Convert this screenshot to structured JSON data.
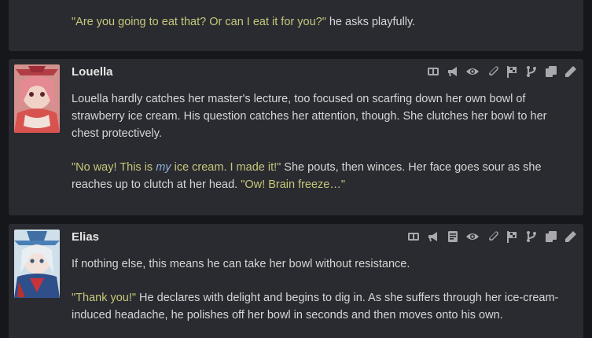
{
  "messages": [
    {
      "name": "",
      "paragraphs": [
        {
          "quote": "\"Are you going to eat that? Or can I eat it for you?\"",
          "rest": " he asks playfully."
        }
      ]
    },
    {
      "name": "Louella",
      "p1": "Louella hardly catches her master's lecture, too focused on scarfing down her own bowl of strawberry ice cream. His question catches her attention, though. She clutches her bowl to her chest protectively.",
      "p2_q1a": "\"No way! This is ",
      "p2_em": "my",
      "p2_q1b": " ice cream. I made it!\"",
      "p2_mid": " She pouts, then winces. Her face goes sour as she reaches up to clutch at her head. ",
      "p2_q2": "\"Ow! Brain freeze…\"",
      "tool_icons": [
        "translate-icon",
        "megaphone-icon",
        "eye-icon",
        "paperclip-icon",
        "flag-icon",
        "branch-icon",
        "copy-icon",
        "pencil-icon"
      ]
    },
    {
      "name": "Elias",
      "p1": "If nothing else, this means he can take her bowl without resistance.",
      "p2_q": "\"Thank you!\"",
      "p2_rest": " He declares with delight and begins to dig in. As she suffers through her ice-cream-induced headache, he polishes off her bowl in seconds and then moves onto his own.",
      "tool_icons": [
        "translate-icon",
        "megaphone-icon",
        "document-icon",
        "eye-icon",
        "paperclip-icon",
        "flag-icon",
        "branch-icon",
        "copy-icon",
        "pencil-icon"
      ]
    }
  ],
  "colors": {
    "background": "#16171b",
    "message_bg": "#2a2b30",
    "quote": "#c6c87a",
    "emphasis": "#8fb3d9"
  }
}
